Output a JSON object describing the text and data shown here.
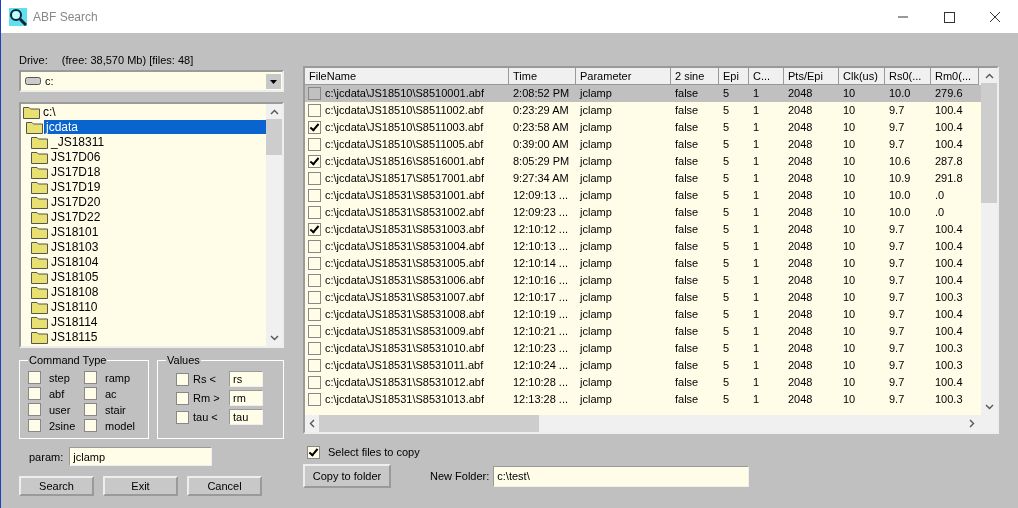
{
  "window": {
    "title": "ABF Search"
  },
  "drive": {
    "label": "Drive:",
    "info": "(free: 38,570 Mb) [files:  48]",
    "value": "c:"
  },
  "tree": [
    {
      "label": "c:\\",
      "selected": false,
      "children": [
        {
          "label": "jcdata",
          "selected": true,
          "children": [
            {
              "label": "_JS18311",
              "selected": false
            },
            {
              "label": "JS17D06",
              "selected": false
            },
            {
              "label": "JS17D18",
              "selected": false
            },
            {
              "label": "JS17D19",
              "selected": false
            },
            {
              "label": "JS17D20",
              "selected": false
            },
            {
              "label": "JS17D22",
              "selected": false
            },
            {
              "label": "JS18101",
              "selected": false
            },
            {
              "label": "JS18103",
              "selected": false
            },
            {
              "label": "JS18104",
              "selected": false
            },
            {
              "label": "JS18105",
              "selected": false
            },
            {
              "label": "JS18108",
              "selected": false
            },
            {
              "label": "JS18110",
              "selected": false
            },
            {
              "label": "JS18114",
              "selected": false
            },
            {
              "label": "JS18115",
              "selected": false
            }
          ]
        }
      ]
    }
  ],
  "command_type": {
    "title": "Command Type",
    "options": [
      {
        "label": "step",
        "checked": false
      },
      {
        "label": "ramp",
        "checked": false
      },
      {
        "label": "abf",
        "checked": false
      },
      {
        "label": "ac",
        "checked": false
      },
      {
        "label": "user",
        "checked": false
      },
      {
        "label": "stair",
        "checked": false
      },
      {
        "label": "2sine",
        "checked": false
      },
      {
        "label": "model",
        "checked": false
      }
    ]
  },
  "values": {
    "title": "Values",
    "rows": [
      {
        "label": "Rs <",
        "checked": false,
        "value": "rs"
      },
      {
        "label": "Rm >",
        "checked": false,
        "value": "rm"
      },
      {
        "label": "tau <",
        "checked": false,
        "value": "tau"
      }
    ]
  },
  "param": {
    "label": "param:",
    "value": "jclamp"
  },
  "buttons": [
    "Search",
    "Exit",
    "Cancel"
  ],
  "table": {
    "columns": [
      "FileName",
      "Time",
      "Parameter",
      "2 sine",
      "Epi",
      "C...",
      "Pts/Epi",
      "Clk(us)",
      "Rs0(...",
      "Rm0(..."
    ],
    "rows": [
      {
        "checked": false,
        "selected": true,
        "cells": [
          "c:\\jcdata\\JS18510\\S8510001.abf",
          "2:08:52 PM",
          "jclamp",
          "false",
          "5",
          "1",
          "2048",
          "10",
          "10.0",
          "279.6"
        ]
      },
      {
        "checked": false,
        "selected": false,
        "cells": [
          "c:\\jcdata\\JS18510\\S8511002.abf",
          "0:23:29 AM",
          "jclamp",
          "false",
          "5",
          "1",
          "2048",
          "10",
          "9.7",
          "100.4"
        ]
      },
      {
        "checked": true,
        "selected": false,
        "cells": [
          "c:\\jcdata\\JS18510\\S8511003.abf",
          "0:23:58 AM",
          "jclamp",
          "false",
          "5",
          "1",
          "2048",
          "10",
          "9.7",
          "100.4"
        ]
      },
      {
        "checked": false,
        "selected": false,
        "cells": [
          "c:\\jcdata\\JS18510\\S8511005.abf",
          "0:39:00 AM",
          "jclamp",
          "false",
          "5",
          "1",
          "2048",
          "10",
          "9.7",
          "100.4"
        ]
      },
      {
        "checked": true,
        "selected": false,
        "cells": [
          "c:\\jcdata\\JS18516\\S8516001.abf",
          "8:05:29 PM",
          "jclamp",
          "false",
          "5",
          "1",
          "2048",
          "10",
          "10.6",
          "287.8"
        ]
      },
      {
        "checked": false,
        "selected": false,
        "cells": [
          "c:\\jcdata\\JS18517\\S8517001.abf",
          "9:27:34 AM",
          "jclamp",
          "false",
          "5",
          "1",
          "2048",
          "10",
          "10.9",
          "291.8"
        ]
      },
      {
        "checked": false,
        "selected": false,
        "cells": [
          "c:\\jcdata\\JS18531\\S8531001.abf",
          "12:09:13 ...",
          "jclamp",
          "false",
          "5",
          "1",
          "2048",
          "10",
          "10.0",
          ".0"
        ]
      },
      {
        "checked": false,
        "selected": false,
        "cells": [
          "c:\\jcdata\\JS18531\\S8531002.abf",
          "12:09:23 ...",
          "jclamp",
          "false",
          "5",
          "1",
          "2048",
          "10",
          "10.0",
          ".0"
        ]
      },
      {
        "checked": true,
        "selected": false,
        "cells": [
          "c:\\jcdata\\JS18531\\S8531003.abf",
          "12:10:12 ...",
          "jclamp",
          "false",
          "5",
          "1",
          "2048",
          "10",
          "9.7",
          "100.4"
        ]
      },
      {
        "checked": false,
        "selected": false,
        "cells": [
          "c:\\jcdata\\JS18531\\S8531004.abf",
          "12:10:13 ...",
          "jclamp",
          "false",
          "5",
          "1",
          "2048",
          "10",
          "9.7",
          "100.4"
        ]
      },
      {
        "checked": false,
        "selected": false,
        "cells": [
          "c:\\jcdata\\JS18531\\S8531005.abf",
          "12:10:14 ...",
          "jclamp",
          "false",
          "5",
          "1",
          "2048",
          "10",
          "9.7",
          "100.4"
        ]
      },
      {
        "checked": false,
        "selected": false,
        "cells": [
          "c:\\jcdata\\JS18531\\S8531006.abf",
          "12:10:16 ...",
          "jclamp",
          "false",
          "5",
          "1",
          "2048",
          "10",
          "9.7",
          "100.4"
        ]
      },
      {
        "checked": false,
        "selected": false,
        "cells": [
          "c:\\jcdata\\JS18531\\S8531007.abf",
          "12:10:17 ...",
          "jclamp",
          "false",
          "5",
          "1",
          "2048",
          "10",
          "9.7",
          "100.3"
        ]
      },
      {
        "checked": false,
        "selected": false,
        "cells": [
          "c:\\jcdata\\JS18531\\S8531008.abf",
          "12:10:19 ...",
          "jclamp",
          "false",
          "5",
          "1",
          "2048",
          "10",
          "9.7",
          "100.4"
        ]
      },
      {
        "checked": false,
        "selected": false,
        "cells": [
          "c:\\jcdata\\JS18531\\S8531009.abf",
          "12:10:21 ...",
          "jclamp",
          "false",
          "5",
          "1",
          "2048",
          "10",
          "9.7",
          "100.4"
        ]
      },
      {
        "checked": false,
        "selected": false,
        "cells": [
          "c:\\jcdata\\JS18531\\S8531010.abf",
          "12:10:23 ...",
          "jclamp",
          "false",
          "5",
          "1",
          "2048",
          "10",
          "9.7",
          "100.3"
        ]
      },
      {
        "checked": false,
        "selected": false,
        "cells": [
          "c:\\jcdata\\JS18531\\S8531011.abf",
          "12:10:24 ...",
          "jclamp",
          "false",
          "5",
          "1",
          "2048",
          "10",
          "9.7",
          "100.3"
        ]
      },
      {
        "checked": false,
        "selected": false,
        "cells": [
          "c:\\jcdata\\JS18531\\S8531012.abf",
          "12:10:28 ...",
          "jclamp",
          "false",
          "5",
          "1",
          "2048",
          "10",
          "9.7",
          "100.4"
        ]
      },
      {
        "checked": false,
        "selected": false,
        "cells": [
          "c:\\jcdata\\JS18531\\S8531013.abf",
          "12:13:28 ...",
          "jclamp",
          "false",
          "5",
          "1",
          "2048",
          "10",
          "9.7",
          "100.3"
        ]
      }
    ]
  },
  "select_files": {
    "label": "Select files to copy",
    "checked": true
  },
  "copy_button": "Copy to folder",
  "new_folder": {
    "label": "New Folder:",
    "value": "c:\\test\\"
  }
}
